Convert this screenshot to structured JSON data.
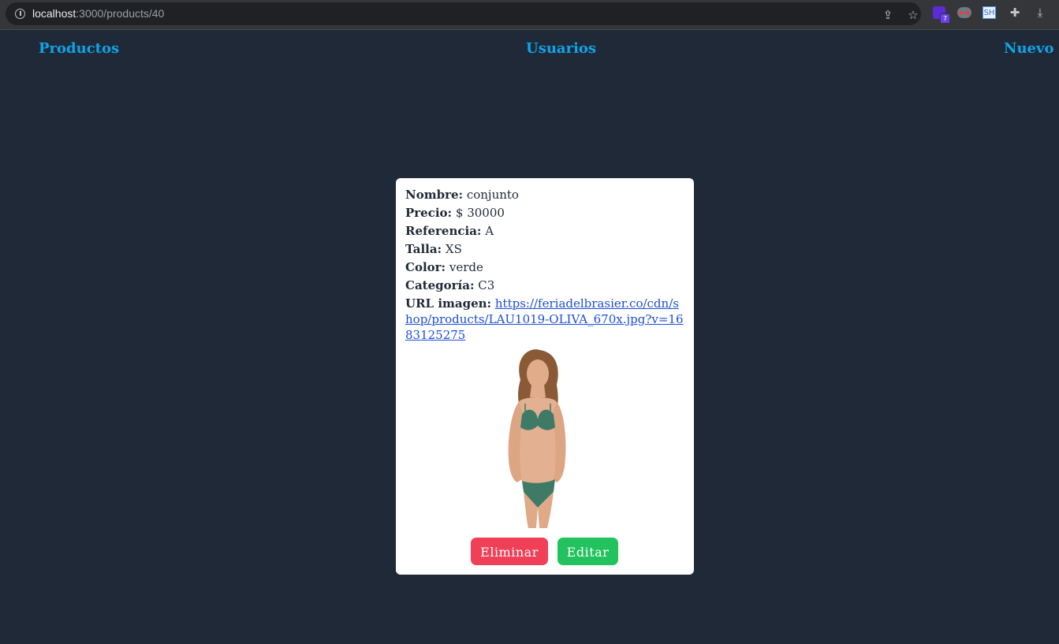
{
  "browser": {
    "url_host": "localhost",
    "url_path": ":3000/products/40",
    "extension_badge": "7",
    "extension_sh": "SH"
  },
  "nav": {
    "products": "Productos",
    "users": "Usuarios",
    "new": "Nuevo"
  },
  "product": {
    "name_label": "Nombre:",
    "name": "conjunto",
    "price_label": "Precio:",
    "price": "$ 30000",
    "reference_label": "Referencia:",
    "reference": "A",
    "size_label": "Talla:",
    "size": "XS",
    "color_label": "Color:",
    "color": "verde",
    "category_label": "Categoría:",
    "category": "C3",
    "image_url_label": "URL imagen:",
    "image_url": "https://feriadelbrasier.co/cdn/shop/products/LAU1019-OLIVA_670x.jpg?v=1683125275"
  },
  "actions": {
    "delete": "Eliminar",
    "edit": "Editar"
  },
  "colors": {
    "background": "#1f2937",
    "nav_link": "#0ea5e9",
    "delete": "#ef4058",
    "edit": "#22c35e"
  }
}
